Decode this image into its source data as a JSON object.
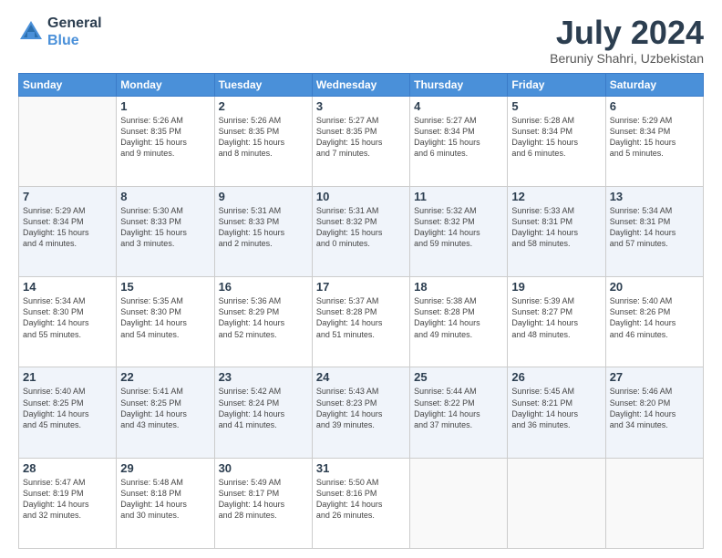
{
  "header": {
    "logo_line1": "General",
    "logo_line2": "Blue",
    "month_title": "July 2024",
    "location": "Beruniy Shahri, Uzbekistan"
  },
  "days_of_week": [
    "Sunday",
    "Monday",
    "Tuesday",
    "Wednesday",
    "Thursday",
    "Friday",
    "Saturday"
  ],
  "weeks": [
    [
      {
        "day": "",
        "info": ""
      },
      {
        "day": "1",
        "info": "Sunrise: 5:26 AM\nSunset: 8:35 PM\nDaylight: 15 hours\nand 9 minutes."
      },
      {
        "day": "2",
        "info": "Sunrise: 5:26 AM\nSunset: 8:35 PM\nDaylight: 15 hours\nand 8 minutes."
      },
      {
        "day": "3",
        "info": "Sunrise: 5:27 AM\nSunset: 8:35 PM\nDaylight: 15 hours\nand 7 minutes."
      },
      {
        "day": "4",
        "info": "Sunrise: 5:27 AM\nSunset: 8:34 PM\nDaylight: 15 hours\nand 6 minutes."
      },
      {
        "day": "5",
        "info": "Sunrise: 5:28 AM\nSunset: 8:34 PM\nDaylight: 15 hours\nand 6 minutes."
      },
      {
        "day": "6",
        "info": "Sunrise: 5:29 AM\nSunset: 8:34 PM\nDaylight: 15 hours\nand 5 minutes."
      }
    ],
    [
      {
        "day": "7",
        "info": "Sunrise: 5:29 AM\nSunset: 8:34 PM\nDaylight: 15 hours\nand 4 minutes."
      },
      {
        "day": "8",
        "info": "Sunrise: 5:30 AM\nSunset: 8:33 PM\nDaylight: 15 hours\nand 3 minutes."
      },
      {
        "day": "9",
        "info": "Sunrise: 5:31 AM\nSunset: 8:33 PM\nDaylight: 15 hours\nand 2 minutes."
      },
      {
        "day": "10",
        "info": "Sunrise: 5:31 AM\nSunset: 8:32 PM\nDaylight: 15 hours\nand 0 minutes."
      },
      {
        "day": "11",
        "info": "Sunrise: 5:32 AM\nSunset: 8:32 PM\nDaylight: 14 hours\nand 59 minutes."
      },
      {
        "day": "12",
        "info": "Sunrise: 5:33 AM\nSunset: 8:31 PM\nDaylight: 14 hours\nand 58 minutes."
      },
      {
        "day": "13",
        "info": "Sunrise: 5:34 AM\nSunset: 8:31 PM\nDaylight: 14 hours\nand 57 minutes."
      }
    ],
    [
      {
        "day": "14",
        "info": "Sunrise: 5:34 AM\nSunset: 8:30 PM\nDaylight: 14 hours\nand 55 minutes."
      },
      {
        "day": "15",
        "info": "Sunrise: 5:35 AM\nSunset: 8:30 PM\nDaylight: 14 hours\nand 54 minutes."
      },
      {
        "day": "16",
        "info": "Sunrise: 5:36 AM\nSunset: 8:29 PM\nDaylight: 14 hours\nand 52 minutes."
      },
      {
        "day": "17",
        "info": "Sunrise: 5:37 AM\nSunset: 8:28 PM\nDaylight: 14 hours\nand 51 minutes."
      },
      {
        "day": "18",
        "info": "Sunrise: 5:38 AM\nSunset: 8:28 PM\nDaylight: 14 hours\nand 49 minutes."
      },
      {
        "day": "19",
        "info": "Sunrise: 5:39 AM\nSunset: 8:27 PM\nDaylight: 14 hours\nand 48 minutes."
      },
      {
        "day": "20",
        "info": "Sunrise: 5:40 AM\nSunset: 8:26 PM\nDaylight: 14 hours\nand 46 minutes."
      }
    ],
    [
      {
        "day": "21",
        "info": "Sunrise: 5:40 AM\nSunset: 8:25 PM\nDaylight: 14 hours\nand 45 minutes."
      },
      {
        "day": "22",
        "info": "Sunrise: 5:41 AM\nSunset: 8:25 PM\nDaylight: 14 hours\nand 43 minutes."
      },
      {
        "day": "23",
        "info": "Sunrise: 5:42 AM\nSunset: 8:24 PM\nDaylight: 14 hours\nand 41 minutes."
      },
      {
        "day": "24",
        "info": "Sunrise: 5:43 AM\nSunset: 8:23 PM\nDaylight: 14 hours\nand 39 minutes."
      },
      {
        "day": "25",
        "info": "Sunrise: 5:44 AM\nSunset: 8:22 PM\nDaylight: 14 hours\nand 37 minutes."
      },
      {
        "day": "26",
        "info": "Sunrise: 5:45 AM\nSunset: 8:21 PM\nDaylight: 14 hours\nand 36 minutes."
      },
      {
        "day": "27",
        "info": "Sunrise: 5:46 AM\nSunset: 8:20 PM\nDaylight: 14 hours\nand 34 minutes."
      }
    ],
    [
      {
        "day": "28",
        "info": "Sunrise: 5:47 AM\nSunset: 8:19 PM\nDaylight: 14 hours\nand 32 minutes."
      },
      {
        "day": "29",
        "info": "Sunrise: 5:48 AM\nSunset: 8:18 PM\nDaylight: 14 hours\nand 30 minutes."
      },
      {
        "day": "30",
        "info": "Sunrise: 5:49 AM\nSunset: 8:17 PM\nDaylight: 14 hours\nand 28 minutes."
      },
      {
        "day": "31",
        "info": "Sunrise: 5:50 AM\nSunset: 8:16 PM\nDaylight: 14 hours\nand 26 minutes."
      },
      {
        "day": "",
        "info": ""
      },
      {
        "day": "",
        "info": ""
      },
      {
        "day": "",
        "info": ""
      }
    ]
  ]
}
